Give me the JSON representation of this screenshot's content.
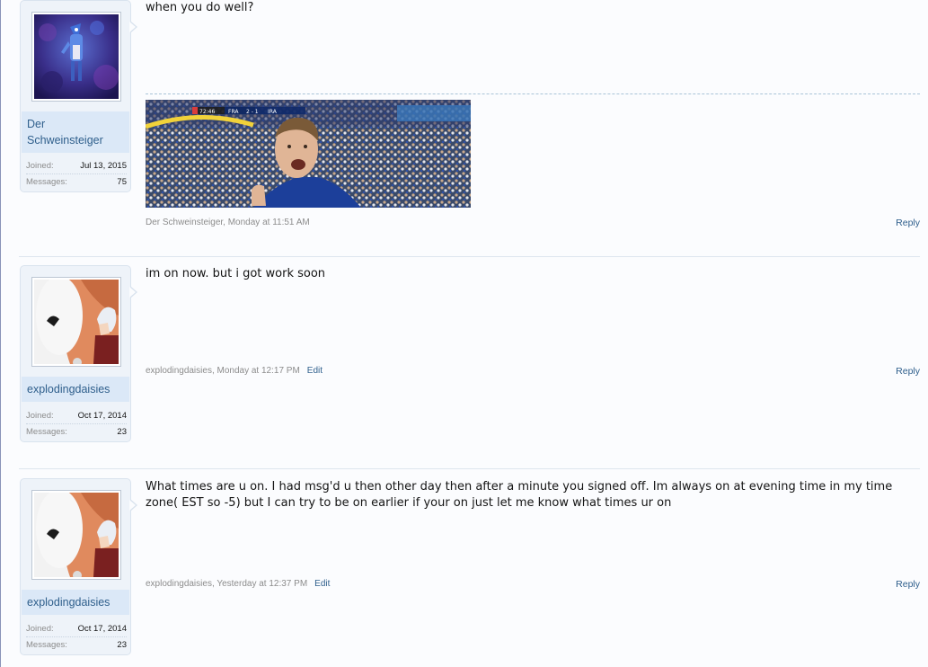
{
  "posts": [
    {
      "username": "Der Schweinsteiger",
      "joined_label": "Joined:",
      "joined": "Jul 13, 2015",
      "messages_label": "Messages:",
      "messages": "75",
      "text": "when you do well?",
      "author": "Der Schweinsteiger",
      "time": "Monday at 11:51 AM",
      "edit": "",
      "reply": "Reply",
      "signature_overlay": {
        "clock": "72:46",
        "team_a": "FRA",
        "score": "2 - 1",
        "team_b": "IRA"
      }
    },
    {
      "username": "explodingdaisies",
      "joined_label": "Joined:",
      "joined": "Oct 17, 2014",
      "messages_label": "Messages:",
      "messages": "23",
      "text": "im on now. but i got work soon",
      "author": "explodingdaisies",
      "time": "Monday at 12:17 PM",
      "edit": "Edit",
      "reply": "Reply"
    },
    {
      "username": "explodingdaisies",
      "joined_label": "Joined:",
      "joined": "Oct 17, 2014",
      "messages_label": "Messages:",
      "messages": "23",
      "text": "What times are u on. I had msg'd u then other day then after a minute you signed off. Im always on at evening time in my time zone( EST so -5) but I can try to be on earlier if your on just let me know what times ur on",
      "author": "explodingdaisies",
      "time": "Yesterday at 12:37 PM",
      "edit": "Edit",
      "reply": "Reply"
    }
  ],
  "meta_separator": ", "
}
